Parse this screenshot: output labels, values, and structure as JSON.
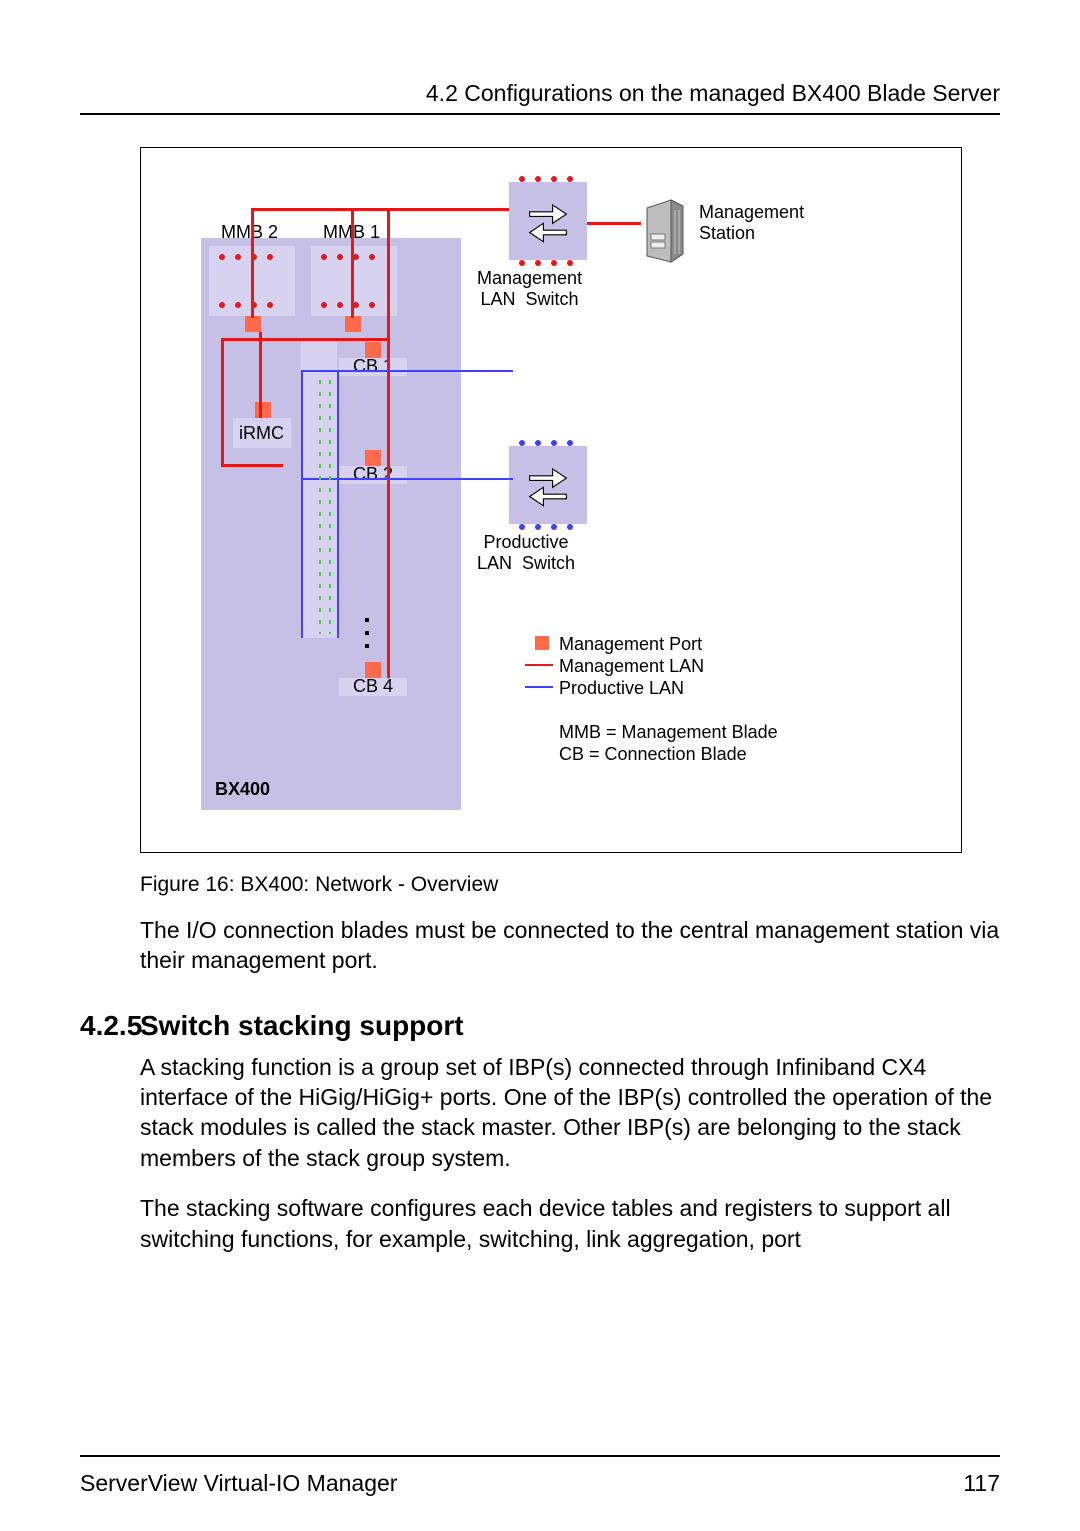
{
  "header": {
    "section_ref": "4.2 Configurations on the managed BX400 Blade Server"
  },
  "diagram": {
    "bx_label": "BX400",
    "mmb2": "MMB 2",
    "mmb1": "MMB 1",
    "irmc": "iRMC",
    "cb1": "CB 1",
    "cb2": "CB 2",
    "cb4": "CB 4",
    "mgmt_switch": "Management\nLAN  Switch",
    "prod_switch": "Productive\nLAN  Switch",
    "mgmt_station": "Management\nStation",
    "legend": {
      "mgmt_port": "Management   Port",
      "mgmt_lan": "Management   LAN",
      "prod_lan": "Productive   LAN",
      "mmb_def": "MMB = Management  Blade",
      "cb_def": "CB     = Connection  Blade"
    }
  },
  "figure_caption": "Figure 16: BX400: Network - Overview",
  "paragraphs": {
    "p1": "The I/O connection blades must be connected to the central management station via their management port."
  },
  "section": {
    "number": "4.2.5",
    "title": "Switch stacking support",
    "body1": "A stacking function is a group set of IBP(s) connected through Infiniband CX4 interface of the HiGig/HiGig+ ports. One of the IBP(s) controlled the operation of the stack modules is called the stack master. Other IBP(s) are belonging to the stack members of the stack group system.",
    "body2": "The stacking software configures each device tables and registers to support all switching functions, for example, switching, link aggregation, port"
  },
  "footer": {
    "product": "ServerView Virtual-IO Manager",
    "pageno": "117"
  }
}
